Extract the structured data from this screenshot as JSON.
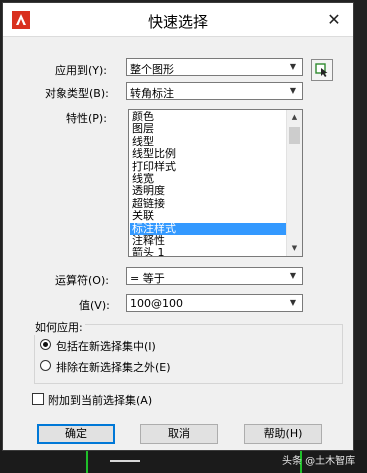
{
  "dialog": {
    "title": "快速选择",
    "close_glyph": "✕"
  },
  "apply_to": {
    "label": "应用到(Y):",
    "value": "整个图形"
  },
  "object_type": {
    "label": "对象类型(B):",
    "value": "转角标注"
  },
  "properties": {
    "label": "特性(P):",
    "items": [
      "颜色",
      "图层",
      "线型",
      "线型比例",
      "打印样式",
      "线宽",
      "透明度",
      "超链接",
      "关联",
      "标注样式",
      "注释性",
      "箭头 1"
    ],
    "selected_index": 9
  },
  "operator": {
    "label": "运算符(O):",
    "value": "= 等于"
  },
  "value_field": {
    "label": "值(V):",
    "value": "100@100"
  },
  "how_to_apply": {
    "label": "如何应用:",
    "include_label": "包括在新选择集中(I)",
    "exclude_label": "排除在新选择集之外(E)",
    "selected": "include"
  },
  "append": {
    "label": "附加到当前选择集(A)",
    "checked": false
  },
  "buttons": {
    "ok": "确定",
    "cancel": "取消",
    "help": "帮助(H)"
  },
  "watermark": "头条 @土木智库",
  "colors": {
    "selection": "#3399ff",
    "default_button_border": "#0078d7",
    "app_icon": "#d9301e"
  }
}
